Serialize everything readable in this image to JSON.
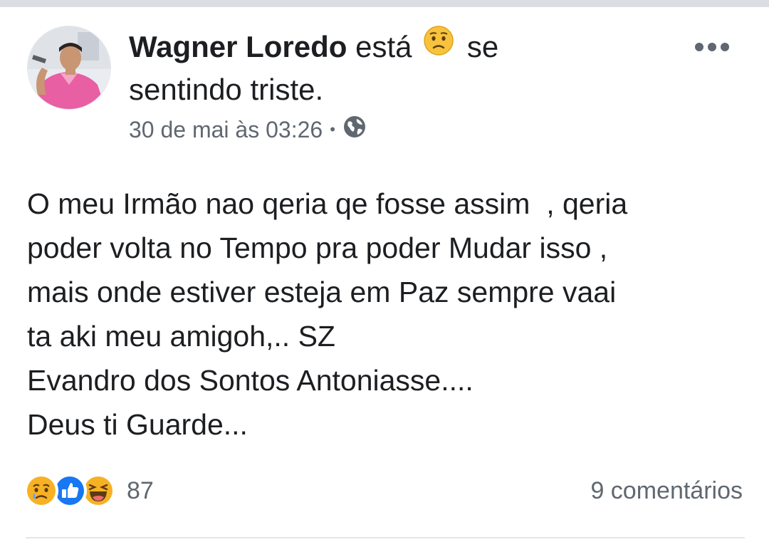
{
  "post": {
    "author_name": "Wagner Loredo",
    "feeling_prefix": "está",
    "feeling_line1_suffix": "se",
    "feeling_line2": "sentindo triste.",
    "timestamp": "30 de mai às 03:26",
    "separator": "•",
    "privacy_icon": "globe-icon",
    "feeling_icon": "sad-face-icon",
    "body_lines": [
      "O meu Irmão nao qeria qe fosse assim  , qeria",
      "poder volta no Tempo pra poder Mudar isso ,",
      "mais onde estiver esteja em Paz sempre vaai",
      "ta aki meu amigoh,.. SZ",
      "Evandro dos Sontos Antoniasse....",
      "Deus ti Guarde..."
    ]
  },
  "reactions": {
    "icons": [
      "sad-reaction-icon",
      "like-reaction-icon",
      "haha-reaction-icon"
    ],
    "count": "87"
  },
  "comments": {
    "label": "9 comentários"
  },
  "colors": {
    "text_primary": "#1c1e21",
    "text_secondary": "#606770",
    "like_blue": "#1877f2",
    "reaction_yellow": "#f7b125"
  }
}
